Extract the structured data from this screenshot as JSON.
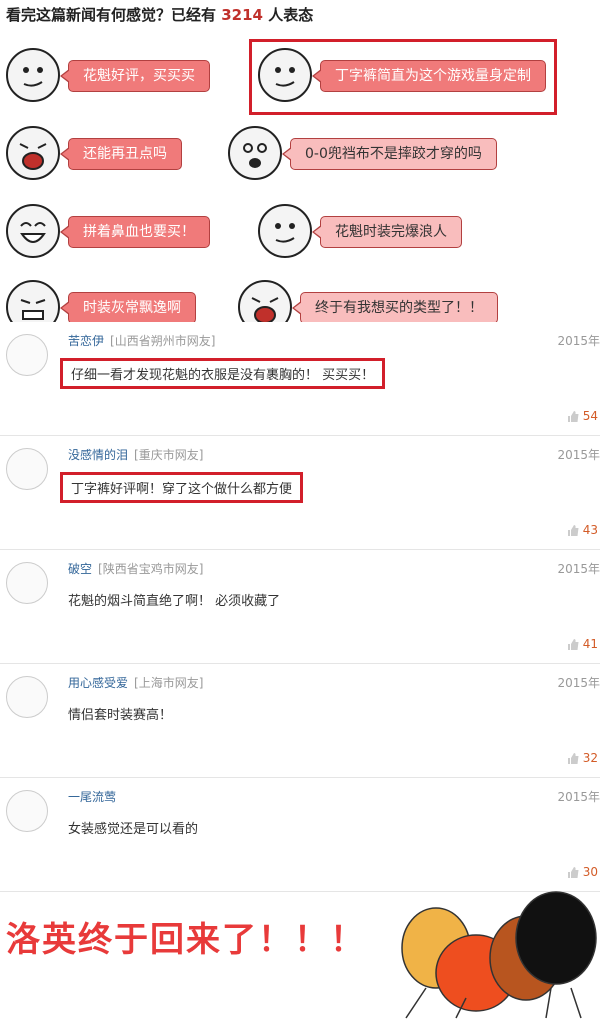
{
  "header": {
    "prefix": "看完这篇新闻有何感觉？已经有",
    "count": "3214",
    "suffix": "人表态"
  },
  "reactions": [
    {
      "label": "花魁好评，买买买",
      "face": "smirk-face-icon"
    },
    {
      "label": "丁字裤简直为这个游戏量身定制",
      "face": "smirk-face-icon",
      "highlighted": true
    },
    {
      "label": "还能再丑点吗",
      "face": "shout-face-icon"
    },
    {
      "label": "0-0兜裆布不是摔跤才穿的吗",
      "face": "shock-face-icon"
    },
    {
      "label": "拼着鼻血也要买！",
      "face": "laugh-face-icon"
    },
    {
      "label": "花魁时装完爆浪人",
      "face": "smirk-face-icon"
    },
    {
      "label": "时装灰常飘逸啊",
      "face": "grin-face-icon"
    },
    {
      "label": "终于有我想买的类型了！！",
      "face": "shout-face-icon"
    }
  ],
  "comments": [
    {
      "user": "苦恋伊",
      "location": "[山西省朔州市网友]",
      "date": "2015年",
      "text": "仔细一看才发现花魁的衣服是没有裹胸的！ 买买买！",
      "likes": "54",
      "highlighted": true
    },
    {
      "user": "没感情的泪",
      "location": "[重庆市网友]",
      "date": "2015年",
      "text": "丁字裤好评啊！穿了这个做什么都方便",
      "likes": "43",
      "highlighted": true
    },
    {
      "user": "破空",
      "location": "[陕西省宝鸡市网友]",
      "date": "2015年",
      "text": "花魁的烟斗简直绝了啊！ 必须收藏了",
      "likes": "41"
    },
    {
      "user": "用心感受爱",
      "location": "[上海市网友]",
      "date": "2015年",
      "text": "情侣套时装赛高！",
      "likes": "32"
    },
    {
      "user": "一尾流莺",
      "location": "",
      "date": "2015年",
      "text": "女装感觉还是可以看的",
      "likes": "30"
    }
  ],
  "banner": {
    "text": "洛英终于回来了！！！"
  },
  "colors": {
    "accent": "#d21f2a",
    "bubble": "#f07a7a",
    "bubble_light": "#f9bdbd",
    "user": "#336699",
    "likes": "#d35c28"
  }
}
